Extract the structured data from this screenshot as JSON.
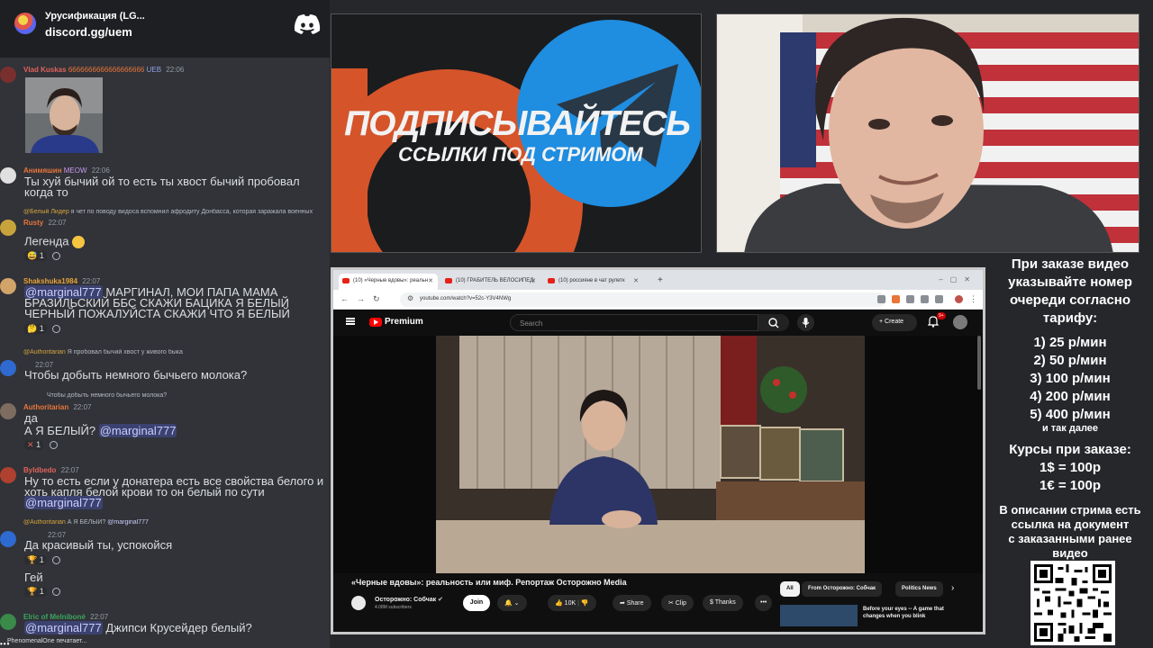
{
  "header": {
    "server_name": "Урусификация (LG...",
    "server_link": "discord.gg/uem"
  },
  "messages": [
    {
      "user": "Vlad Kuskas",
      "user_color": "#e0625a",
      "badge": "UEB",
      "time": "22:06",
      "text": "6666666666666666666"
    },
    {
      "user": "Анимяшин",
      "user_color": "#e8753a",
      "badge": "MEOW",
      "time": "22:06",
      "text": "Ты хуй бычий ой то есть ты хвост бычий пробовал когда то"
    },
    {
      "reply_user": "@Белый Лидер",
      "reply_text": "я чет по поводу видоса вспомнил афродиту Донбасса, которая заражала военных",
      "user": "Rusty",
      "user_color": "#e8753a",
      "time": "22:07",
      "text": "Легенда",
      "reaction": "1"
    },
    {
      "user": "Shakshuka1984",
      "user_color": "#e8a33a",
      "time": "22:07",
      "mention": "@marginal777",
      "text": "МАРГИНАЛ, МОИ ПАПА МАМА БРАЗИЛЬСКИЙ ББС СКАЖИ БАЦИКА Я БЕЛЫЙ ЧЕРНЫЙ ПОЖАЛУЙСТА СКАЖИ ЧТО Я БЕЛЫЙ",
      "reaction": "1"
    },
    {
      "reply_user": "@Authoritarian",
      "reply_text": "Я пробовал бычий хвост у живого быка",
      "time": "22:07",
      "text": "Чтобы добыть немного бычьего молока?"
    },
    {
      "reply_text": "Чтобы добыть немного бычьего молока?",
      "user": "Authoritarian",
      "user_color": "#e8753a",
      "time": "22:07",
      "text": "да",
      "text2": "А Я БЕЛЫЙ?",
      "mention": "@marginal777",
      "reaction": "1"
    },
    {
      "user": "Byldbedo",
      "user_color": "#e0625a",
      "time": "22:07",
      "text": "Ну то есть если у донатера есть все свойства белого и хоть капля белой крови то он белый по сути",
      "mention": "@marginal777"
    },
    {
      "reply_user": "@Authoritarian",
      "reply_text": "А Я БЕЛЫЙ?",
      "reply_mention": "@marginal777",
      "time": "22:07",
      "text": "Да красивый ты, успокойся",
      "reaction": "1"
    },
    {
      "text": "Гей",
      "reaction": "1"
    },
    {
      "user": "Elric of Melniboné",
      "user_color": "#3ba55c",
      "time": "22:07",
      "mention": "@marginal777",
      "text": "Джипси Крусейдер белый?"
    }
  ],
  "typing": "PhenomenalOne печатает...",
  "promo": {
    "title": "ПОДПИСЫВАЙТЕСЬ",
    "subtitle": "ССЫЛКИ ПОД СТРИМОМ"
  },
  "browser": {
    "tabs": [
      {
        "label": "(10) «Черные вдовы»: реальн"
      },
      {
        "label": "(10) ГРАБИТЕЛЬ ВЕЛОСИПЕД"
      },
      {
        "label": "(10) россияне в чат рулетк"
      }
    ],
    "url": "youtube.com/watch?v=52c-Y3V4NWg",
    "yt_brand": "Premium",
    "search_placeholder": "Search",
    "create_label": "Create",
    "notif_count": "9+"
  },
  "video": {
    "title": "«Черные вдовы»: реальность или миф. Репортаж Осторожно Media",
    "channel": "Осторожно: Собчак",
    "subscribers": "4.08M subscribers",
    "join": "Join",
    "likes": "10K",
    "share": "Share",
    "clip": "Clip",
    "thanks": "Thanks",
    "chips": [
      "All",
      "From Осторожно: Собчак",
      "Politics News"
    ],
    "rec_title": "Before your eyes -- A game that changes when you blink"
  },
  "info": {
    "lines1": [
      "При заказе видео",
      "указывайте номер",
      "очереди согласно",
      "тарифу:"
    ],
    "prices": [
      "1) 25 р/мин",
      "2) 50 р/мин",
      "3) 100 р/мин",
      "4) 200 р/мин",
      "5) 400 р/мин"
    ],
    "etc": "и так далее",
    "courses_title": "Курсы при заказе:",
    "courses": [
      "1$ = 100р",
      "1€ = 100р"
    ],
    "footer": [
      "В описании стрима есть",
      "ссылка на документ",
      "с заказанными ранее",
      "видео"
    ]
  },
  "colors": {
    "discord_bg": "#313338",
    "mention_bg": "#3c4270",
    "yt_red": "#ff0000",
    "promo_blue": "#1f8de0",
    "promo_orange": "#e05a2b"
  }
}
